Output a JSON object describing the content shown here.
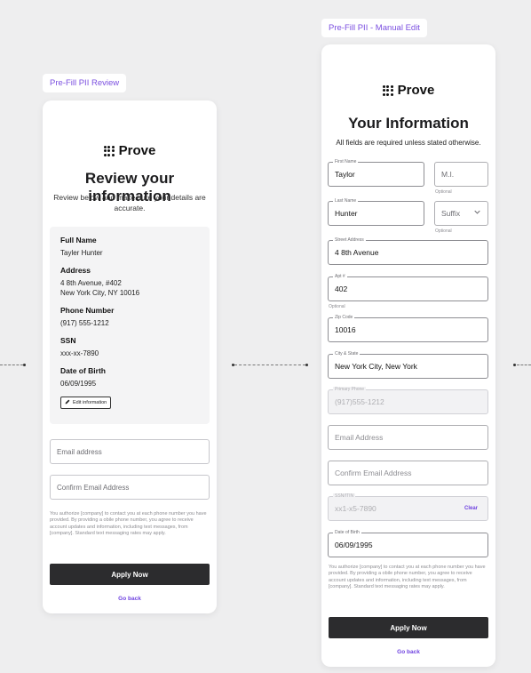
{
  "labels": {
    "review_tag": "Pre-Fill PII Review",
    "manual_tag": "Pre-Fill PII - Manual Edit"
  },
  "review": {
    "brand": "Prove",
    "title": "Review your information",
    "subtitle": "Review below and make sure your details are accurate.",
    "full_name_label": "Full Name",
    "full_name_value": "Tayler Hunter",
    "address_label": "Address",
    "address_line1": "4 8th Avenue, #402",
    "address_line2": "New York City, NY 10016",
    "phone_label": "Phone Number",
    "phone_value": "(917) 555-1212",
    "ssn_label": "SSN",
    "ssn_value": "xxx-xx-7890",
    "dob_label": "Date of Birth",
    "dob_value": "06/09/1995",
    "edit_label": "Edit information",
    "email_placeholder": "Email address",
    "confirm_email_placeholder": "Confirm Email Address",
    "disclaimer": "You authorize [company] to contact you at each phone number you have provided. By providing a obile phone number, you agree to receive account updates and information, including text messages, from [company]. Standard text messaging rates may apply.",
    "apply_label": "Apply Now",
    "back_label": "Go back"
  },
  "manual": {
    "brand": "Prove",
    "title": "Your Information",
    "subtitle": "All fields are required unless stated otherwise.",
    "first_name_label": "First Name",
    "first_name_value": "Taylor",
    "mi_placeholder": "M.I.",
    "optional": "Optional",
    "last_name_label": "Last Name",
    "last_name_value": "Hunter",
    "suffix_placeholder": "Suffix",
    "street_label": "Street Address",
    "street_value": "4 8th Avenue",
    "apt_label": "Apt #",
    "apt_value": "402",
    "zip_label": "Zip Code",
    "zip_value": "10016",
    "city_label": "City & State",
    "city_value": "New York City, New York",
    "phone_label": "Primary Phone",
    "phone_value": "(917)555-1212",
    "email_placeholder": "Email Address",
    "confirm_email_placeholder": "Confirm Email Address",
    "ssn_label": "SSN/ITIN",
    "ssn_value": "xx1-x5-7890",
    "clear_label": "Clear",
    "dob_label": "Date of Birth",
    "dob_value": "06/09/1995",
    "disclaimer": "You authorize [company] to contact you at each phone number you have provided. By providing a obile phone number, you agree to receive account updates and information, including text messages, from [company]. Standard text messaging rates may apply.",
    "apply_label": "Apply Now",
    "back_label": "Go back"
  }
}
